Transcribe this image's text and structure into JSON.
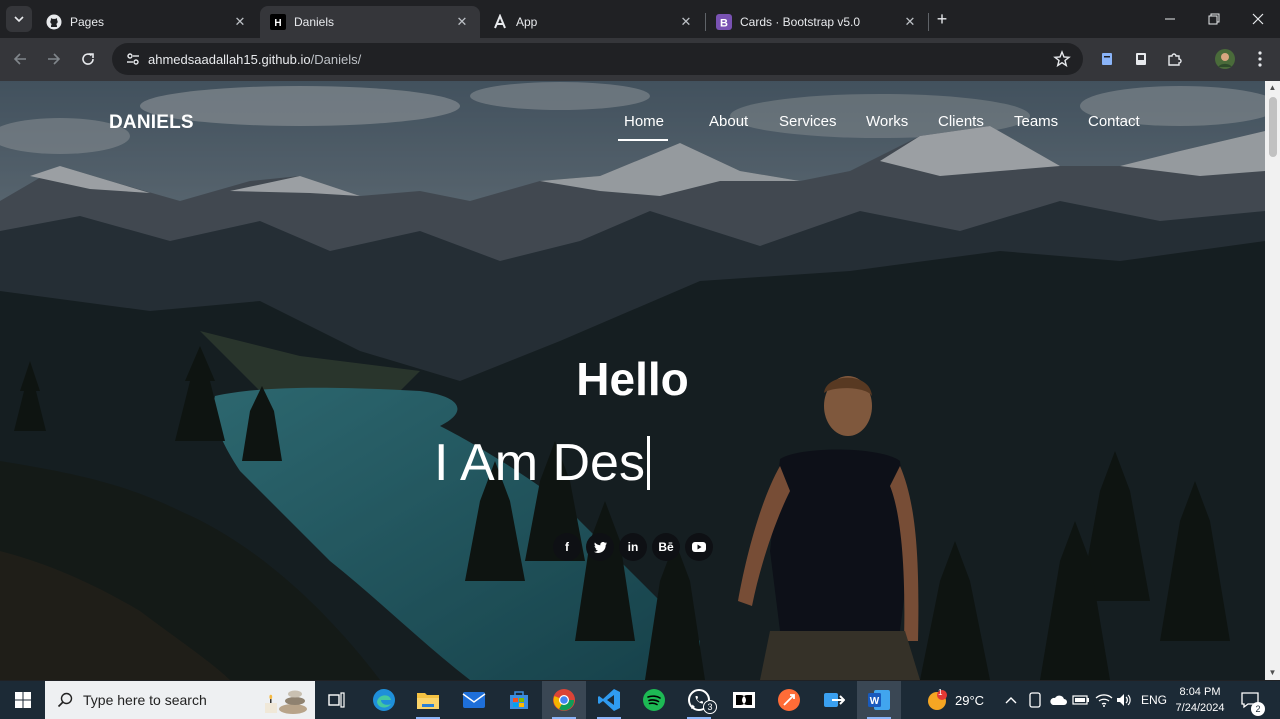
{
  "browser": {
    "tabs": [
      {
        "title": "Pages",
        "icon": "github-icon",
        "active": false
      },
      {
        "title": "Daniels",
        "icon": "site-h-icon",
        "active": true
      },
      {
        "title": "App",
        "icon": "app-a-icon",
        "active": false
      },
      {
        "title": "Cards · Bootstrap v5.0",
        "icon": "bootstrap-icon",
        "active": false
      }
    ],
    "url_host": "ahmedsaadallah15.github.io",
    "url_path": "/Daniels/"
  },
  "page": {
    "brand": "DANIELS",
    "nav": [
      "Home",
      "About",
      "Services",
      "Works",
      "Clients",
      "Teams",
      "Contact"
    ],
    "active_nav": "Home",
    "hello": "Hello",
    "typed": "I Am Des",
    "social": [
      {
        "icon": "facebook-icon",
        "glyph": "f"
      },
      {
        "icon": "twitter-icon",
        "glyph": "t"
      },
      {
        "icon": "linkedin-icon",
        "glyph": "in"
      },
      {
        "icon": "behance-icon",
        "glyph": "Bē"
      },
      {
        "icon": "youtube-icon",
        "glyph": "▶"
      }
    ]
  },
  "taskbar": {
    "search_placeholder": "Type here to search",
    "weather": "29°C",
    "language": "ENG",
    "time": "8:04 PM",
    "date": "7/24/2024",
    "whatsapp_badge": "3",
    "notification_badge": "2",
    "weather_badge": "1"
  }
}
